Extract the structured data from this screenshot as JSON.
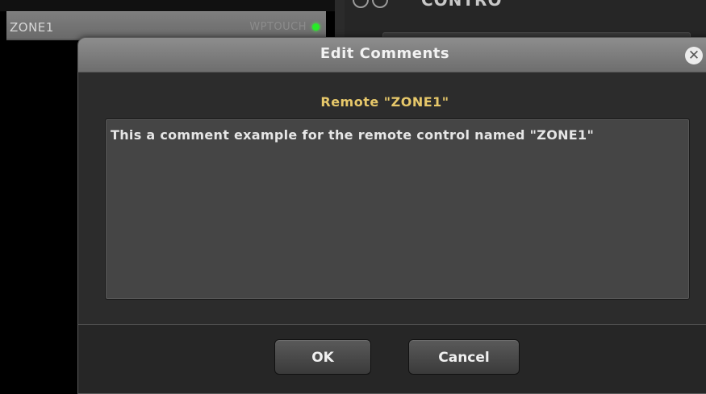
{
  "background": {
    "zone_list": [
      {
        "name": "ZONE1",
        "type": "WPTOUCH",
        "status_color": "#27ec27"
      }
    ],
    "right_panel": {
      "title": "CONTRO"
    }
  },
  "dialog": {
    "title": "Edit Comments",
    "close_icon": "close-icon",
    "subtitle": "Remote \"ZONE1\"",
    "comment": "This a comment example for the remote control named \"ZONE1\"",
    "ok_label": "OK",
    "cancel_label": "Cancel"
  },
  "colors": {
    "accent": "#e7c86a",
    "status_online": "#27ec27"
  }
}
